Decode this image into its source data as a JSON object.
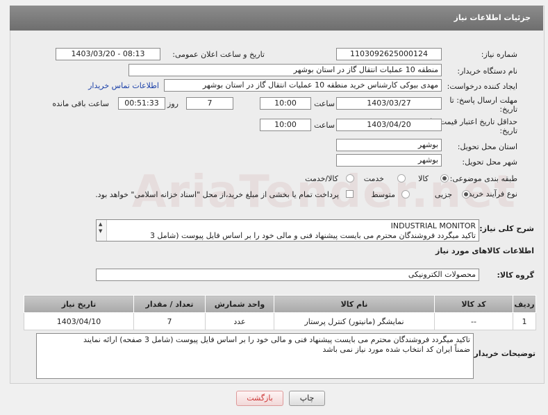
{
  "header": {
    "title": "جزئیات اطلاعات نیاز"
  },
  "fields": {
    "need_number_label": "شماره نیاز:",
    "need_number": "1103092625000124",
    "announce_label": "تاریخ و ساعت اعلان عمومی:",
    "announce_value": "1403/03/20 - 08:13",
    "buyer_org_label": "نام دستگاه خریدار:",
    "buyer_org": "منطقه 10 عملیات انتقال گاز در استان بوشهر",
    "creator_label": "ایجاد کننده درخواست:",
    "creator": "مهدی بیوکی کارشناس خرید منطقه 10 عملیات انتقال گاز در استان بوشهر",
    "contact_link": "اطلاعات تماس خریدار",
    "deadline_label_1": "مهلت ارسال پاسخ: تا",
    "deadline_label_2": "تاریخ:",
    "deadline_date": "1403/03/27",
    "time_label": "ساعت",
    "deadline_time": "10:00",
    "days_value": "7",
    "days_label": "روز و",
    "remaining_time": "00:51:33",
    "remaining_label": "ساعت باقی مانده",
    "validity_label_1": "حداقل تاریخ اعتبار قیمت: تا",
    "validity_label_2": "تاریخ:",
    "validity_date": "1403/04/20",
    "validity_time": "10:00",
    "province_label": "استان محل تحویل:",
    "province": "بوشهر",
    "city_label": "شهر محل تحویل:",
    "city": "بوشهر",
    "category_label": "طبقه بندی موضوعی:",
    "category_options": [
      "کالا",
      "خدمت",
      "کالا/خدمت"
    ],
    "process_label": "نوع فرآیند خرید :",
    "process_options": [
      "جزیی",
      "متوسط"
    ],
    "payment_note": "پرداخت تمام یا بخشی از مبلغ خرید،از محل \"اسناد خزانه اسلامی\" خواهد بود."
  },
  "description": {
    "label": "شرح کلی نیاز:",
    "line1": "INDUSTRIAL MONITOR",
    "line2": "تاکید میگردد فروشندگان محترم می بایست پیشنهاد فنی و مالی خود را بر اساس فایل پیوست (شامل 3"
  },
  "goods": {
    "section_title": "اطلاعات کالاهای مورد نیاز",
    "group_label": "گروه کالا:",
    "group_value": "محصولات الکترونیکی",
    "columns": [
      "ردیف",
      "کد کالا",
      "نام کالا",
      "واحد شمارش",
      "تعداد / مقدار",
      "تاریخ نیاز"
    ],
    "rows": [
      [
        "1",
        "--",
        "نمایشگر (مانیتور) کنترل پرستار",
        "عدد",
        "7",
        "1403/04/10"
      ]
    ]
  },
  "buyer_notes": {
    "label": "توضیحات خریدار:",
    "line1": "تاکید میگردد فروشندگان محترم می بایست پیشنهاد فنی و مالی خود را بر اساس فایل پیوست (شامل 3 صفحه) ارائه نمایند",
    "line2": "ضمناً ایران کد انتخاب شده مورد نیاز نمی باشد"
  },
  "buttons": {
    "print": "چاپ",
    "back": "بازگشت"
  }
}
